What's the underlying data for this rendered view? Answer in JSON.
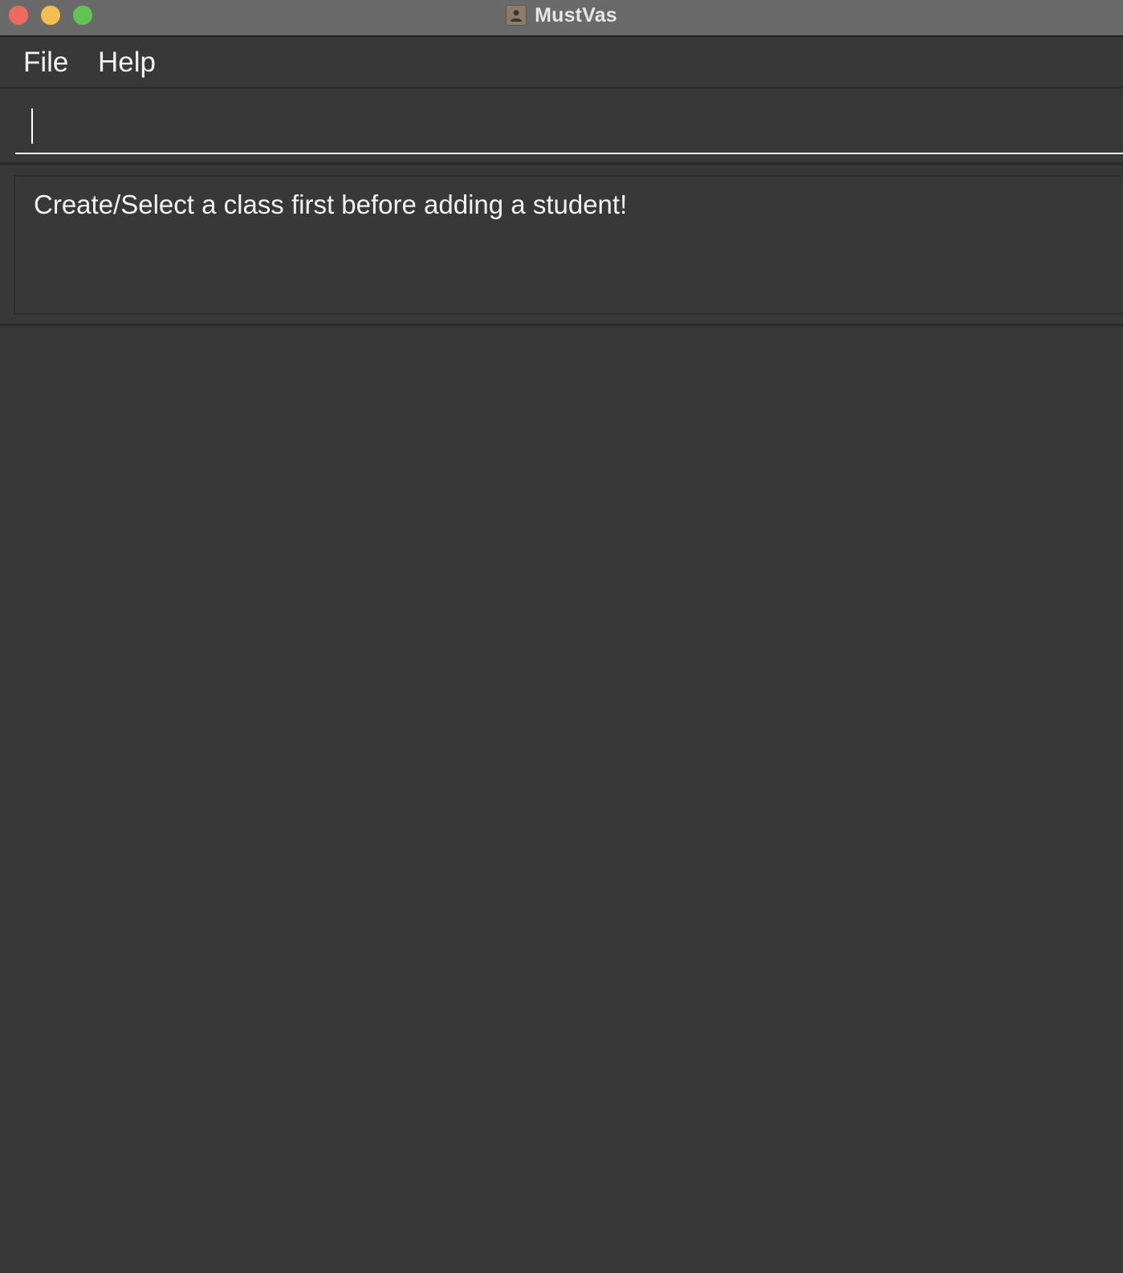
{
  "window": {
    "title": "MustVas",
    "app_icon": "contact-card-icon"
  },
  "menubar": {
    "items": [
      {
        "label": "File"
      },
      {
        "label": "Help"
      }
    ]
  },
  "command_box": {
    "value": "",
    "placeholder": ""
  },
  "result_display": {
    "message": "Create/Select a class first before adding a student!"
  },
  "colors": {
    "background": "#383838",
    "titlebar": "#6a6a6a",
    "text": "#f2f2f2",
    "close": "#ed6a5e",
    "minimize": "#f5bf4f",
    "zoom": "#61c554"
  }
}
